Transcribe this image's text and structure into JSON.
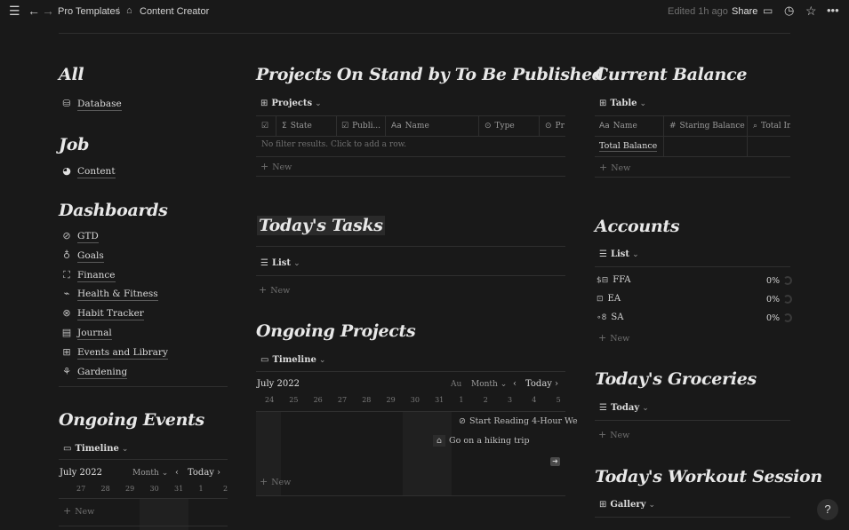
{
  "topbar": {
    "crumb_parent": "Pro Templates",
    "crumb_sep": "/",
    "crumb_current": "Content Creator",
    "edited": "Edited 1h ago",
    "share": "Share"
  },
  "left": {
    "all_title": "All",
    "all_items": [
      {
        "label": "Database",
        "icon": "database-icon"
      }
    ],
    "job_title": "Job",
    "job_items": [
      {
        "label": "Content",
        "icon": "content-icon"
      }
    ],
    "dash_title": "Dashboards",
    "dash_items": [
      {
        "label": "GTD",
        "icon": "check-circle-icon"
      },
      {
        "label": "Goals",
        "icon": "award-icon"
      },
      {
        "label": "Finance",
        "icon": "nodes-icon"
      },
      {
        "label": "Health & Fitness",
        "icon": "pulse-icon"
      },
      {
        "label": "Habit Tracker",
        "icon": "compass-icon"
      },
      {
        "label": "Journal",
        "icon": "book-icon"
      },
      {
        "label": "Events and Library",
        "icon": "grid-icon"
      },
      {
        "label": "Gardening",
        "icon": "plant-icon"
      }
    ],
    "events_title": "Ongoing Events",
    "events_view": "Timeline",
    "events_month": "July 2022",
    "events_scale": "Month",
    "events_today": "Today",
    "events_days": [
      "27",
      "28",
      "29",
      "30",
      "31",
      "1",
      "2"
    ],
    "events_new": "New"
  },
  "middle": {
    "projects_title": "Projects On Stand by To Be Published",
    "projects_view": "Projects",
    "projects_cols": [
      "State",
      "Publi...",
      "Name",
      "Type",
      "Pr"
    ],
    "projects_empty": "No filter results. Click to add a row.",
    "projects_new": "New",
    "tasks_title": "Today's Tasks",
    "tasks_view": "List",
    "tasks_new": "New",
    "ongoing_title": "Ongoing Projects",
    "ongoing_view": "Timeline",
    "ongoing_month": "July 2022",
    "ongoing_aug": "Au",
    "ongoing_scale": "Month",
    "ongoing_today": "Today",
    "ongoing_days": [
      "24",
      "25",
      "26",
      "27",
      "28",
      "29",
      "30",
      "31",
      "1",
      "2",
      "3",
      "4",
      "5"
    ],
    "ongoing_card1": "Start Reading 4-Hour We",
    "ongoing_card2": "Go on a hiking trip",
    "ongoing_new": "New"
  },
  "right": {
    "balance_title": "Current Balance",
    "balance_view": "Table",
    "balance_cols": [
      "Name",
      "Staring Balance",
      "Total In"
    ],
    "balance_row": "Total Balance",
    "balance_new": "New",
    "accounts_title": "Accounts",
    "accounts_view": "List",
    "accounts": [
      {
        "label": "FFA",
        "pct": "0%"
      },
      {
        "label": "EA",
        "pct": "0%"
      },
      {
        "label": "SA",
        "pct": "0%"
      }
    ],
    "accounts_new": "New",
    "groceries_title": "Today's Groceries",
    "groceries_view": "Today",
    "groceries_new": "New",
    "workout_title": "Today's Workout Session",
    "workout_view": "Gallery"
  },
  "help": "?"
}
